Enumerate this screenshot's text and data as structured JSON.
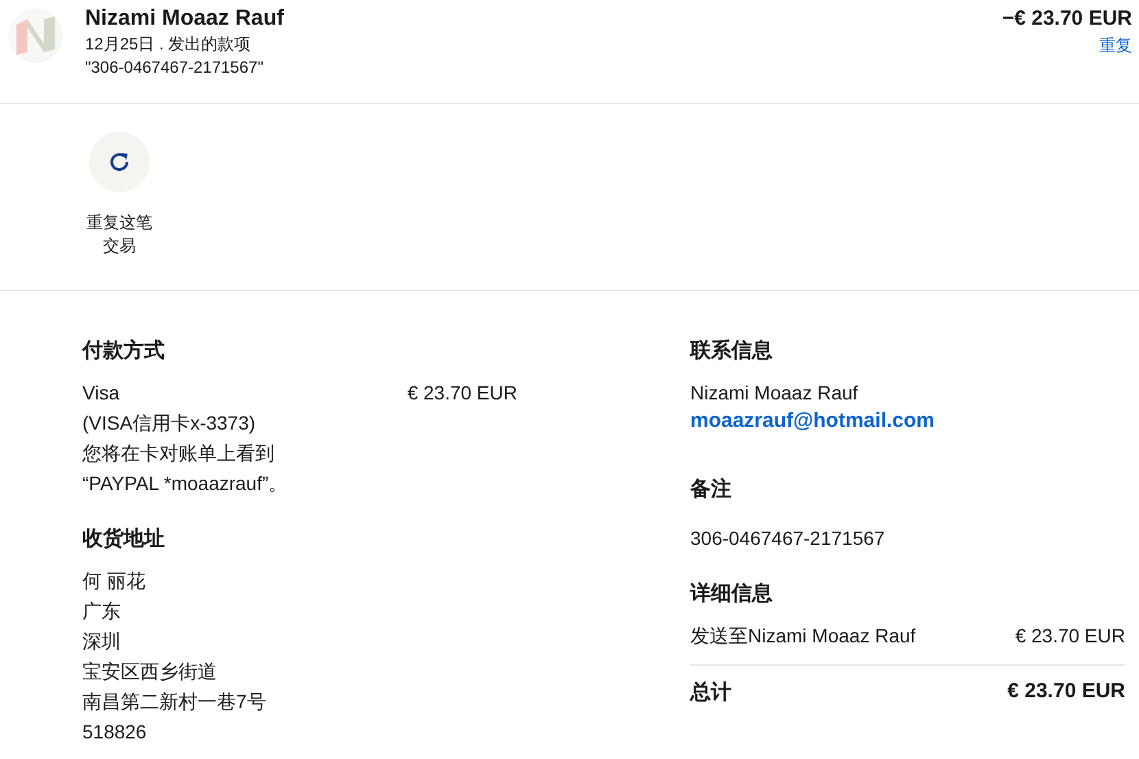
{
  "header": {
    "name": "Nizami Moaaz Rauf",
    "subtitle": "12月25日 . 发出的款项",
    "reference": "\"306-0467467-2171567\"",
    "amount": "−€ 23.70 EUR",
    "repeat_link": "重复"
  },
  "action": {
    "label": "重复这笔交易"
  },
  "payment": {
    "title": "付款方式",
    "method": "Visa",
    "card": "(VISA信用卡x-3373)",
    "statement_note": "您将在卡对账单上看到",
    "statement_name": "“PAYPAL *moaazrauf”。",
    "amount": "€ 23.70 EUR"
  },
  "shipping": {
    "title": "收货地址",
    "lines": [
      "何 丽花",
      "广东",
      "深圳",
      "宝安区西乡街道",
      "南昌第二新村一巷7号",
      "518826"
    ]
  },
  "contact": {
    "title": "联系信息",
    "name": "Nizami Moaaz Rauf",
    "email": "moaazrauf@hotmail.com"
  },
  "notes": {
    "title": "备注",
    "text": "306-0467467-2171567"
  },
  "details": {
    "title": "详细信息",
    "item": "发送至Nizami Moaaz Rauf",
    "item_amount": "€ 23.70 EUR",
    "total_label": "总计",
    "total_amount": "€ 23.70 EUR"
  }
}
